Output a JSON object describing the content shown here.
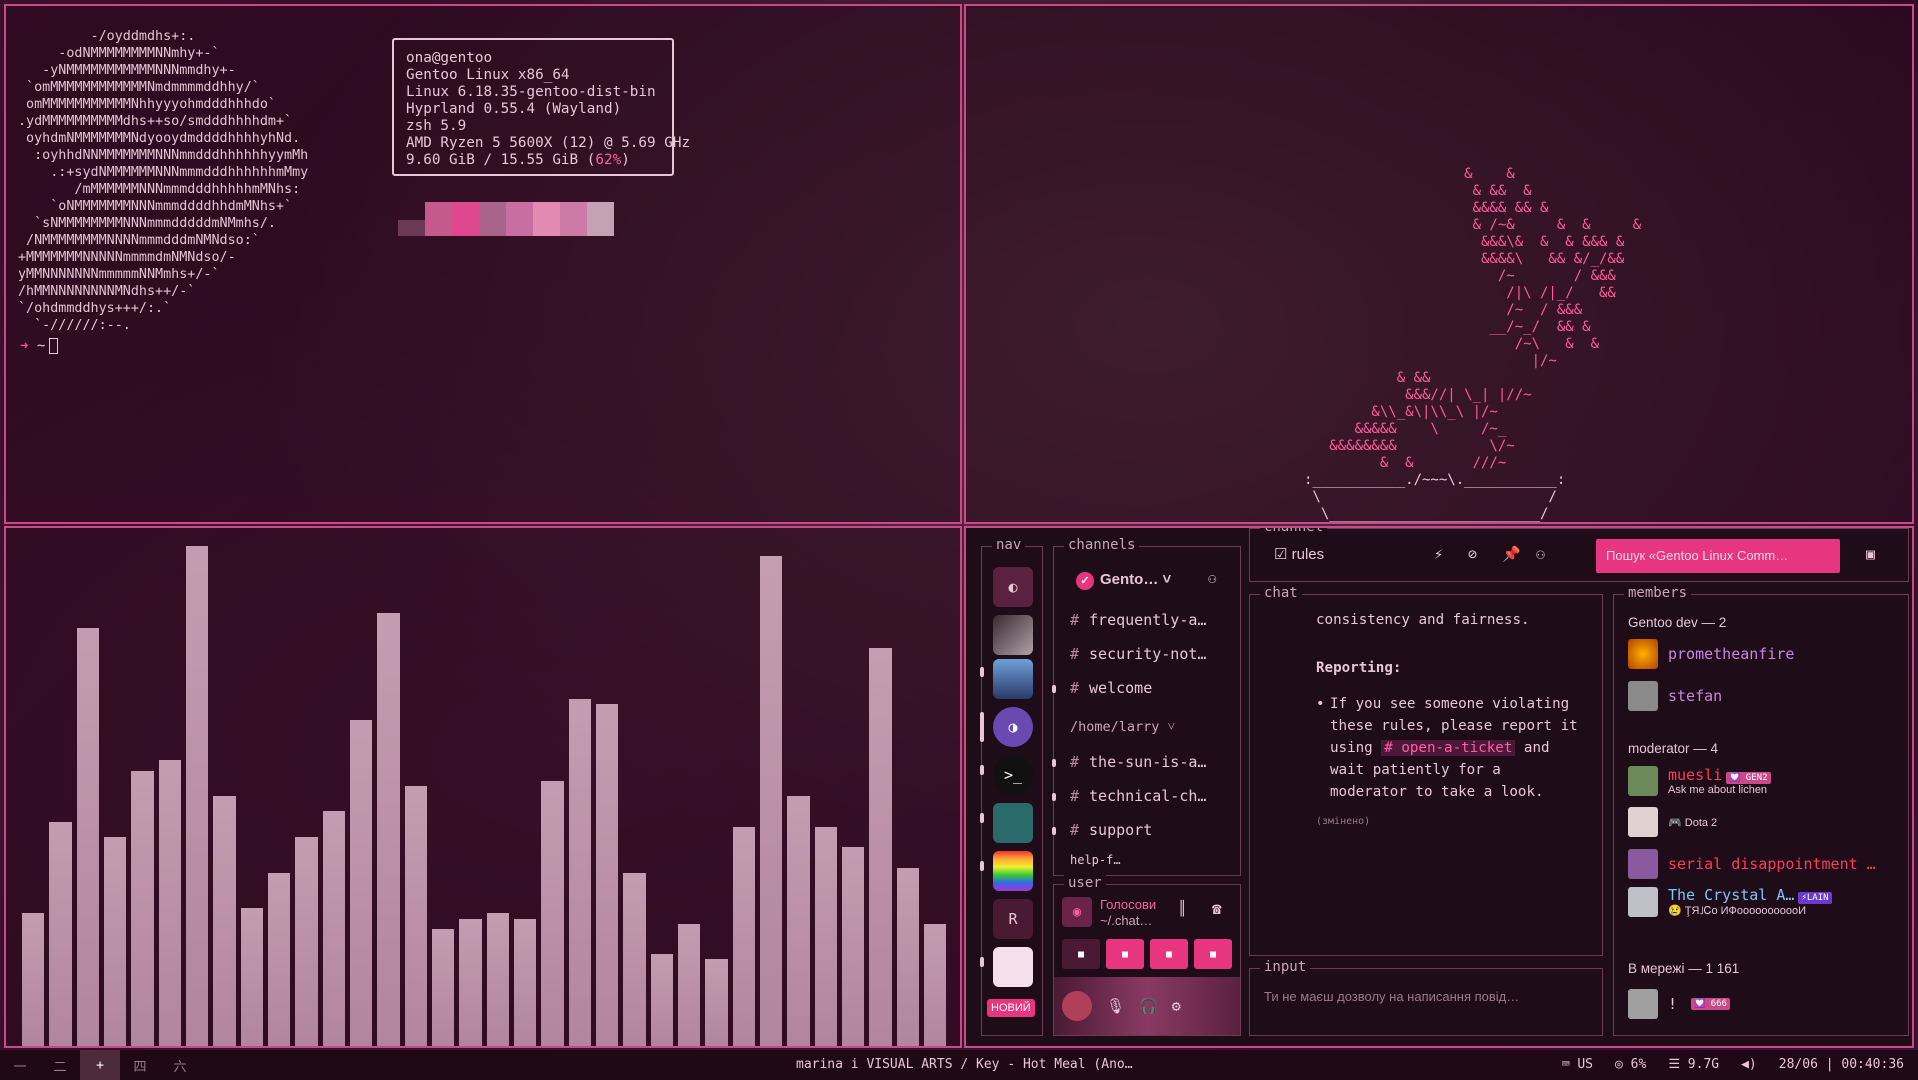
{
  "fetch": {
    "logo_lines": [
      "         -/oyddmdhs+:.",
      "     -odNMMMMMMMMNNmhy+-`",
      "   -yNMMMMMMMMMMMNNNmmdhy+-",
      " `omMMMMMMMMMMMMNmdmmmmddhhy/`",
      " omMMMMMMMMMMMNhhyyyohmdddhhhdo`",
      ".ydMMMMMMMMMMdhs++so/smdddhhhhdm+`",
      " oyhdmNMMMMMMMNdyooydmddddhhhhyhNd.",
      "  :oyhhdNNMMMMMMMNNNmmdddhhhhhhyymMh",
      "    .:+sydNMMMMMMNNNmmmdddhhhhhhmMmy",
      "       /mMMMMMMNNNmmmdddhhhhhmMNhs:",
      "    `oNMMMMMMMNNNmmmddddhhdmMNhs+`",
      "  `sNMMMMMMMMNNNmmmdddddmNMmhs/.",
      " /NMMMMMMMMNNNNmmmdddmNMNdso:`",
      "+MMMMMMMNNNNNmmmmdmNMNdso/-",
      "yMMNNNNNNNmmmmmNNMmhs+/-`",
      "/hMMNNNNNNNNMNdhs++/-`",
      "`/ohdmmddhys+++/:.`",
      "  `-//////:--."
    ],
    "info_lines": [
      "ona@gentoo",
      "Gentoo Linux x86_64",
      "Linux 6.18.35-gentoo-dist-bin",
      "Hyprland 0.55.4 (Wayland)",
      "zsh 5.9",
      "AMD Ryzen 5 5600X (12) @ 5.69 GHz"
    ],
    "memory_text": "9.60 GiB / 15.55 GiB (",
    "memory_pct": "62%",
    "memory_close": ")",
    "swatch_colors": [
      "#6a3a54",
      "#c45a8c",
      "#e0488d",
      "#a8648a",
      "#c66fa0",
      "#e38ab2",
      "#ce7aa6",
      "#c6a0b4"
    ],
    "prompt_arrow": "➜",
    "prompt_dir": "~"
  },
  "plant": {
    "lines": [
      "                   &    &",
      "                    & &&  &",
      "                    &&&& && &",
      "                    & /~&     &  &     &",
      "                     &&&\\&  &  & &&& &",
      "                     &&&&\\   && &/_/&&",
      "                       /~       / &&&",
      "                        /|\\ /|_/   &&",
      "                        /~  / &&&",
      "                      __/~_/  && &",
      "                         /~\\   &  &",
      "                           |/~",
      "           & &&          ",
      "            &&&//| \\_| |//~",
      "        &\\\\_&\\|\\\\_\\ |/~",
      "      &&&&&    \\     /~_",
      "   &&&&&&&&           \\/~",
      "         &  &       ///~"
    ],
    "pot_lines": [
      ":___________./~~~\\.___________:",
      " \\                           /",
      "  \\_________________________/",
      "  (_)                     (_)"
    ]
  },
  "visualizer": {
    "levels": [
      0.26,
      0.44,
      0.82,
      0.41,
      0.54,
      0.56,
      0.98,
      0.49,
      0.27,
      0.34,
      0.41,
      0.46,
      0.64,
      0.85,
      0.51,
      0.23,
      0.25,
      0.26,
      0.25,
      0.52,
      0.68,
      0.67,
      0.34,
      0.18,
      0.24,
      0.17,
      0.43,
      0.96,
      0.49,
      0.43,
      0.39,
      0.78,
      0.35,
      0.24
    ]
  },
  "discord": {
    "nav_label": "nav",
    "channels_label": "channels",
    "channel_label": "channel",
    "chat_label": "chat",
    "input_label": "input",
    "members_label": "members",
    "user_label": "user",
    "nav_new_badge": "НОВИЙ",
    "nav_r_label": "R",
    "guild_name": "Gento…",
    "channels": [
      {
        "name": "frequently-a…"
      },
      {
        "name": "security-not…"
      },
      {
        "name": "welcome"
      }
    ],
    "category": "/home/larry ˅",
    "channels2": [
      {
        "name": "the-sun-is-a…"
      },
      {
        "name": "technical-ch…"
      },
      {
        "name": "support"
      },
      {
        "name": "help-f…"
      }
    ],
    "voice_title": "Голосови",
    "voice_sub": "~/.chat…",
    "current_channel": "rules",
    "search_placeholder": "Пошук «Gentoo Linux Comm…",
    "chat": {
      "para1": "consistency and fairness.",
      "heading": "Reporting:",
      "bullet_a": "If you see someone violating these rules, please report it using ",
      "mention": "# open-a-ticket",
      "bullet_b": " and wait patiently for a moderator to take a look.",
      "edited": "(змінено)"
    },
    "input_placeholder": "Ти не маєш дозволу на написання повід…",
    "members": {
      "group1": "Gentoo dev — 2",
      "m1": "prometheanfire",
      "m2": "stefan",
      "group2": "moderator — 4",
      "m3": "muesli",
      "m3_tag": "💟 GEN2",
      "m3_sub": "Ask me about lichen",
      "m4_sub": "🎮 Dota 2",
      "m5": "serial disappointment …",
      "m6": "The Crystal A…",
      "m6_tag": "⚡LAIN",
      "m6_sub": "😢 ŢЯ˩Ꮯo ИФooooooooooИ",
      "group3": "В мережі — 1 161",
      "m7": "!",
      "m7_tag": "💟 666"
    }
  },
  "bar": {
    "workspaces": [
      "一",
      "二",
      "+",
      "四",
      "六"
    ],
    "now_playing": "marina i VISUAL ARTS / Key - Hot Meal (Ano…",
    "layout": "US",
    "cpu": "6%",
    "mem": "9.7G",
    "datetime": "28/06 | 00:40:36"
  }
}
